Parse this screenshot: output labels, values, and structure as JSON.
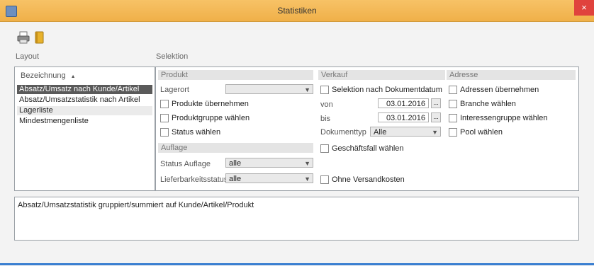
{
  "window": {
    "title": "Statistiken",
    "close_glyph": "×"
  },
  "toolbar": {
    "icons": [
      "print-icon",
      "book-icon"
    ]
  },
  "layout": {
    "label": "Layout",
    "header": "Bezeichnung",
    "sort_glyph": "▲",
    "items": [
      "Absatz/Umsatz nach Kunde/Artikel",
      "Absatz/Umsatzstatistik nach Artikel",
      "Lagerliste",
      "Mindestmengenliste"
    ],
    "selected": "Absatz/Umsatz nach Kunde/Artikel"
  },
  "selektion": {
    "label": "Selektion",
    "produkt": {
      "head": "Produkt",
      "lagerort_label": "Lagerort",
      "lagerort_value": "",
      "cb_produkte": "Produkte übernehmen",
      "cb_produktgruppe": "Produktgruppe wählen",
      "cb_status": "Status wählen"
    },
    "auflage": {
      "head": "Auflage",
      "status_label": "Status Auflage",
      "status_value": "alle",
      "liefer_label": "Lieferbarkeitsstatus",
      "liefer_value": "alle"
    },
    "verkauf": {
      "head": "Verkauf",
      "cb_selektion": "Selektion nach Dokumentdatum",
      "von_label": "von",
      "von_value": "03.01.2016",
      "bis_label": "bis",
      "bis_value": "03.01.2016",
      "dokumenttyp_label": "Dokumenttyp",
      "dokumenttyp_value": "Alle",
      "cb_geschaeftsfall": "Geschäftsfall wählen",
      "cb_versandkosten": "Ohne Versandkosten",
      "datebtn_glyph": "..."
    },
    "adresse": {
      "head": "Adresse",
      "cb_adressen": "Adressen übernehmen",
      "cb_branche": "Branche wählen",
      "cb_interessengruppe": "Interessengruppe wählen",
      "cb_pool": "Pool wählen"
    }
  },
  "description": "Absatz/Umsatzstatistik gruppiert/summiert auf Kunde/Artikel/Produkt"
}
